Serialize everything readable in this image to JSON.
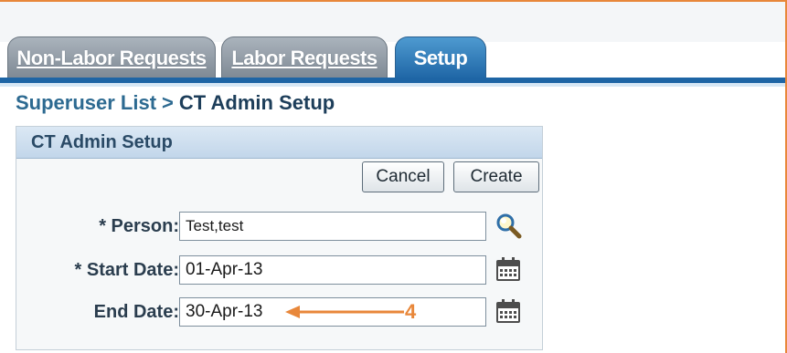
{
  "tabs": [
    {
      "label": "Non-Labor Requests",
      "active": false
    },
    {
      "label": "Labor Requests",
      "active": false
    },
    {
      "label": "Setup",
      "active": true
    }
  ],
  "breadcrumb": {
    "link": "Superuser List",
    "separator": ">",
    "current": "CT Admin Setup"
  },
  "panel": {
    "title": "CT Admin Setup",
    "cancel_label": "Cancel",
    "create_label": "Create"
  },
  "form": {
    "person_label": "* Person:",
    "person_value": "Test,test",
    "start_label": "* Start Date:",
    "start_value": "01-Apr-13",
    "end_label": "End Date:",
    "end_value": "30-Apr-13"
  },
  "annotation": {
    "step_number": "4",
    "color": "#e8873a"
  },
  "colors": {
    "tab_active": "#1e65a5",
    "tab_inactive": "#8a96a1",
    "link": "#2d6a91",
    "annotation": "#e8873a"
  },
  "icons": [
    "search-icon",
    "calendar-icon"
  ]
}
